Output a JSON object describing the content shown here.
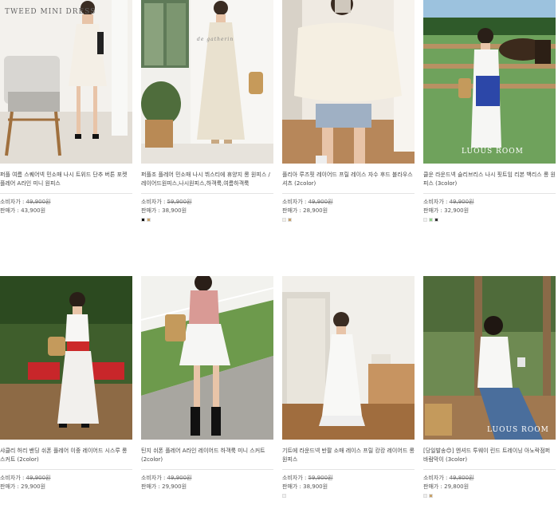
{
  "labels": {
    "consumer": "소비자가 : ",
    "sale": "판매가 : "
  },
  "products": [
    {
      "overlay": "TWEED MINI DRESS",
      "name": "퍼플 여름 스퀘어넥 민소매 나시 트위드 단추 버튼 포켓 플레어 A라인 미니 원피스",
      "consumer_price": "49,900원",
      "sale_price": "43,900원",
      "swatches": []
    },
    {
      "overlay": "de gatherin",
      "name": "퍼플조 플레어 민소매 나시 뷔스티에 휴양지 롱 원피스 / 레이어드원피스,나시원피스,하객룩,여름하객룩",
      "consumer_price": "59,900원",
      "sale_price": "38,900원",
      "swatches": [
        "#111111",
        "#c8a26a"
      ]
    },
    {
      "overlay": "",
      "name": "플리아 루즈핏 레이어드 프릴 레이스 자수 후드 블라우스 셔츠 (2color)",
      "consumer_price": "49,900원",
      "sale_price": "28,900원",
      "swatches": [
        "#f3efe6",
        "#c8a26a"
      ]
    },
    {
      "overlay": "LUOUS ROOM",
      "name": "클운 라운드넥 슬리브리스 나시 핏트임 리본 백리스 롱 원피스 (3color)",
      "consumer_price": "49,900원",
      "sale_price": "32,900원",
      "swatches": [
        "#f2f2f2",
        "#8fd18a",
        "#333333"
      ]
    },
    {
      "overlay": "",
      "name": "샤클리 허리 밴딩 쉬폰 플레어 이중 레이어드 시스루 롱 스커트 (2color)",
      "consumer_price": "49,900원",
      "sale_price": "29,900원",
      "swatches": []
    },
    {
      "overlay": "",
      "name": "틴지 쉬폰 플레어 A라인 레이어드 하객룩 미니 스커트 (2color)",
      "consumer_price": "49,900원",
      "sale_price": "29,900원",
      "swatches": []
    },
    {
      "overlay": "",
      "name": "기트에 라운드넥 반팔 소매 레이스 프릴 캉캉 레이어드 롱 원피스",
      "consumer_price": "59,900원",
      "sale_price": "38,900원",
      "swatches": [
        "#f2f2f2"
      ]
    },
    {
      "overlay": "LUOUS ROOM",
      "name": "[당일발송😊] 엔셔드 투웨이 린드 트레이닝 아노락점퍼 바람막이 (3color)",
      "consumer_price": "49,800원",
      "sale_price": "29,800원",
      "swatches": [
        "#eeeeee",
        "#c8a26a"
      ]
    }
  ]
}
